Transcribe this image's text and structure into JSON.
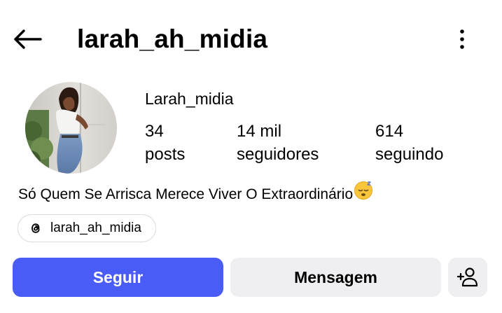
{
  "header": {
    "title": "larah_ah_midia",
    "back_icon": "back-arrow-icon",
    "more_icon": "more-vertical-icon"
  },
  "profile": {
    "display_name": "Larah_midia",
    "avatar_icon": "profile-photo",
    "stats": {
      "posts_count": "34",
      "posts_label": "posts",
      "followers_count": "14 mil",
      "followers_label": "seguidores",
      "following_count": "614",
      "following_label": "seguindo"
    },
    "bio": "Só Quem Se Arrisca Merece Viver O Extraordinário",
    "bio_emoji": "sleeping-face-emoji",
    "threads": {
      "icon": "threads-icon",
      "handle": "larah_ah_midia"
    }
  },
  "actions": {
    "follow_label": "Seguir",
    "message_label": "Mensagem",
    "add_user_icon": "add-user-icon"
  },
  "colors": {
    "primary_button": "#4a5cf6",
    "secondary_button": "#efeff2",
    "pill_border": "#dbdbdb"
  }
}
